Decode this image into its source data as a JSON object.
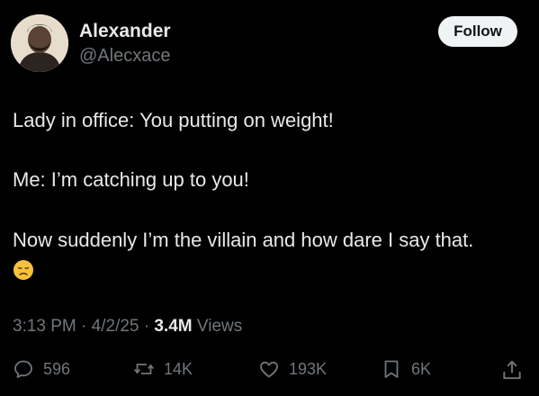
{
  "user": {
    "name": "Alexander",
    "handle": "@Alecxace",
    "avatar_icon": "profile-photo"
  },
  "follow_button": {
    "label": "Follow"
  },
  "tweet": {
    "lines": [
      "Lady in office: You putting on weight!",
      "Me: I’m catching up to you!",
      "Now suddenly I’m the villain and how dare I say that."
    ],
    "emoji": "disappointed-face"
  },
  "meta": {
    "time": "3:13 PM",
    "sep1": " · ",
    "date": "4/2/25",
    "sep2": " · ",
    "views_count": "3.4M",
    "views_label": " Views"
  },
  "actions": {
    "replies": "596",
    "reposts": "14K",
    "likes": "193K",
    "bookmarks": "6K"
  },
  "colors": {
    "background": "#000000",
    "text": "#e7e9ea",
    "secondary": "#71767b",
    "button_bg": "#eff3f4"
  }
}
